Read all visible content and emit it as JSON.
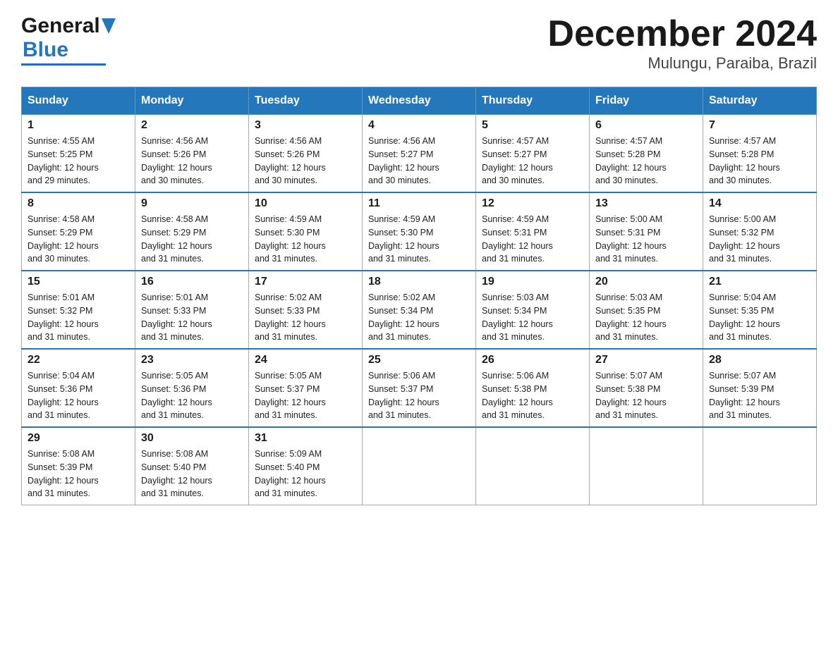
{
  "header": {
    "logo_general": "General",
    "logo_blue": "Blue",
    "month_title": "December 2024",
    "location": "Mulungu, Paraiba, Brazil"
  },
  "weekdays": [
    "Sunday",
    "Monday",
    "Tuesday",
    "Wednesday",
    "Thursday",
    "Friday",
    "Saturday"
  ],
  "weeks": [
    [
      {
        "day": "1",
        "sunrise": "4:55 AM",
        "sunset": "5:25 PM",
        "daylight": "12 hours and 29 minutes."
      },
      {
        "day": "2",
        "sunrise": "4:56 AM",
        "sunset": "5:26 PM",
        "daylight": "12 hours and 30 minutes."
      },
      {
        "day": "3",
        "sunrise": "4:56 AM",
        "sunset": "5:26 PM",
        "daylight": "12 hours and 30 minutes."
      },
      {
        "day": "4",
        "sunrise": "4:56 AM",
        "sunset": "5:27 PM",
        "daylight": "12 hours and 30 minutes."
      },
      {
        "day": "5",
        "sunrise": "4:57 AM",
        "sunset": "5:27 PM",
        "daylight": "12 hours and 30 minutes."
      },
      {
        "day": "6",
        "sunrise": "4:57 AM",
        "sunset": "5:28 PM",
        "daylight": "12 hours and 30 minutes."
      },
      {
        "day": "7",
        "sunrise": "4:57 AM",
        "sunset": "5:28 PM",
        "daylight": "12 hours and 30 minutes."
      }
    ],
    [
      {
        "day": "8",
        "sunrise": "4:58 AM",
        "sunset": "5:29 PM",
        "daylight": "12 hours and 30 minutes."
      },
      {
        "day": "9",
        "sunrise": "4:58 AM",
        "sunset": "5:29 PM",
        "daylight": "12 hours and 31 minutes."
      },
      {
        "day": "10",
        "sunrise": "4:59 AM",
        "sunset": "5:30 PM",
        "daylight": "12 hours and 31 minutes."
      },
      {
        "day": "11",
        "sunrise": "4:59 AM",
        "sunset": "5:30 PM",
        "daylight": "12 hours and 31 minutes."
      },
      {
        "day": "12",
        "sunrise": "4:59 AM",
        "sunset": "5:31 PM",
        "daylight": "12 hours and 31 minutes."
      },
      {
        "day": "13",
        "sunrise": "5:00 AM",
        "sunset": "5:31 PM",
        "daylight": "12 hours and 31 minutes."
      },
      {
        "day": "14",
        "sunrise": "5:00 AM",
        "sunset": "5:32 PM",
        "daylight": "12 hours and 31 minutes."
      }
    ],
    [
      {
        "day": "15",
        "sunrise": "5:01 AM",
        "sunset": "5:32 PM",
        "daylight": "12 hours and 31 minutes."
      },
      {
        "day": "16",
        "sunrise": "5:01 AM",
        "sunset": "5:33 PM",
        "daylight": "12 hours and 31 minutes."
      },
      {
        "day": "17",
        "sunrise": "5:02 AM",
        "sunset": "5:33 PM",
        "daylight": "12 hours and 31 minutes."
      },
      {
        "day": "18",
        "sunrise": "5:02 AM",
        "sunset": "5:34 PM",
        "daylight": "12 hours and 31 minutes."
      },
      {
        "day": "19",
        "sunrise": "5:03 AM",
        "sunset": "5:34 PM",
        "daylight": "12 hours and 31 minutes."
      },
      {
        "day": "20",
        "sunrise": "5:03 AM",
        "sunset": "5:35 PM",
        "daylight": "12 hours and 31 minutes."
      },
      {
        "day": "21",
        "sunrise": "5:04 AM",
        "sunset": "5:35 PM",
        "daylight": "12 hours and 31 minutes."
      }
    ],
    [
      {
        "day": "22",
        "sunrise": "5:04 AM",
        "sunset": "5:36 PM",
        "daylight": "12 hours and 31 minutes."
      },
      {
        "day": "23",
        "sunrise": "5:05 AM",
        "sunset": "5:36 PM",
        "daylight": "12 hours and 31 minutes."
      },
      {
        "day": "24",
        "sunrise": "5:05 AM",
        "sunset": "5:37 PM",
        "daylight": "12 hours and 31 minutes."
      },
      {
        "day": "25",
        "sunrise": "5:06 AM",
        "sunset": "5:37 PM",
        "daylight": "12 hours and 31 minutes."
      },
      {
        "day": "26",
        "sunrise": "5:06 AM",
        "sunset": "5:38 PM",
        "daylight": "12 hours and 31 minutes."
      },
      {
        "day": "27",
        "sunrise": "5:07 AM",
        "sunset": "5:38 PM",
        "daylight": "12 hours and 31 minutes."
      },
      {
        "day": "28",
        "sunrise": "5:07 AM",
        "sunset": "5:39 PM",
        "daylight": "12 hours and 31 minutes."
      }
    ],
    [
      {
        "day": "29",
        "sunrise": "5:08 AM",
        "sunset": "5:39 PM",
        "daylight": "12 hours and 31 minutes."
      },
      {
        "day": "30",
        "sunrise": "5:08 AM",
        "sunset": "5:40 PM",
        "daylight": "12 hours and 31 minutes."
      },
      {
        "day": "31",
        "sunrise": "5:09 AM",
        "sunset": "5:40 PM",
        "daylight": "12 hours and 31 minutes."
      },
      null,
      null,
      null,
      null
    ]
  ],
  "labels": {
    "sunrise": "Sunrise:",
    "sunset": "Sunset:",
    "daylight": "Daylight:"
  }
}
